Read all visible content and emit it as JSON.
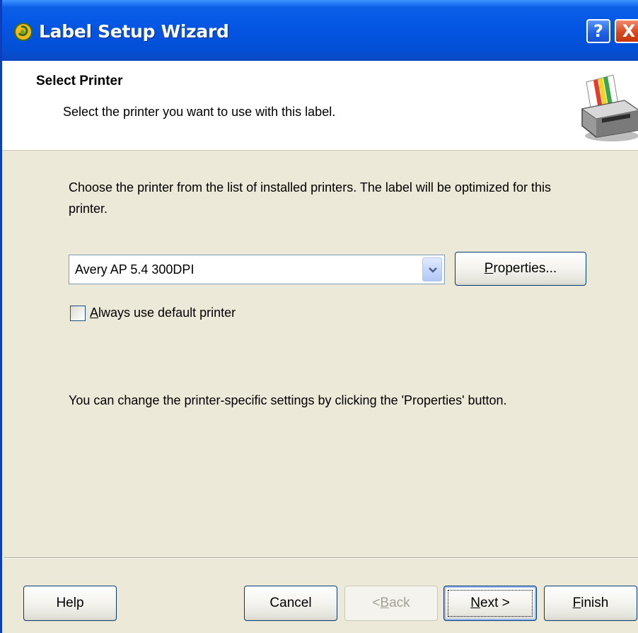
{
  "window": {
    "title": "Label Setup Wizard",
    "help_button": "?",
    "close_button": "X"
  },
  "header": {
    "title": "Select Printer",
    "subtitle": "Select the printer you want to use with this label."
  },
  "body": {
    "description": "Choose the printer from the list of installed printers. The label will be optimized for this printer.",
    "printer_select": {
      "selected": "Avery AP 5.4 300DPI"
    },
    "properties_button": {
      "mnemonic": "P",
      "rest": "roperties..."
    },
    "default_printer_checkbox": {
      "mnemonic": "A",
      "rest": "lways use default printer",
      "checked": false
    },
    "note": "You can change the printer-specific settings by clicking the 'Properties' button."
  },
  "footer": {
    "help": "Help",
    "cancel": "Cancel",
    "back": {
      "prefix": "< ",
      "mnemonic": "B",
      "rest": "ack",
      "disabled": true
    },
    "next": {
      "mnemonic": "N",
      "rest": "ext >"
    },
    "finish": {
      "mnemonic": "F",
      "rest": "inish"
    }
  },
  "colors": {
    "titlebar": "#0454e2",
    "dialog_bg": "#ece9d8",
    "close_button": "#d5451c",
    "button_border": "#003c74"
  },
  "icons": [
    "wizard-app-icon",
    "printer-icon",
    "chevron-down-icon"
  ]
}
